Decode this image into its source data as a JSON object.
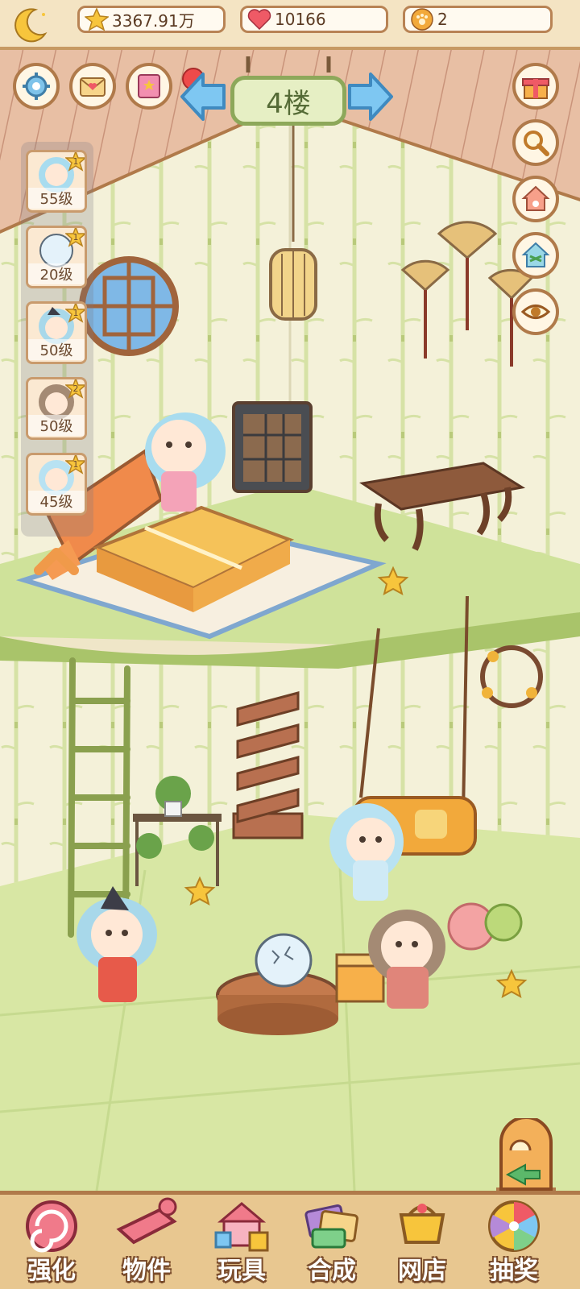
{
  "resources": {
    "stars": "3367.91万",
    "hearts": "10166",
    "paw_coins": "2"
  },
  "floor": {
    "label": "4楼"
  },
  "characters": [
    {
      "level": "55级",
      "badge": "1"
    },
    {
      "level": "20级",
      "badge": "1"
    },
    {
      "level": "50级",
      "badge": "1"
    },
    {
      "level": "50级",
      "badge": "2"
    },
    {
      "level": "45级",
      "badge": "1"
    }
  ],
  "left_buttons": [
    "gear-icon",
    "envelope-heart-icon",
    "book-icon"
  ],
  "right_buttons": [
    "gift-icon",
    "magnifier-icon",
    "house-paw-icon",
    "house-share-icon",
    "eye-icon"
  ],
  "nav": [
    {
      "label": "强化",
      "icon": "lollipop-icon"
    },
    {
      "label": "物件",
      "icon": "piano-icon"
    },
    {
      "label": "玩具",
      "icon": "toy-house-icon"
    },
    {
      "label": "合成",
      "icon": "cards-icon"
    },
    {
      "label": "网店",
      "icon": "shop-basket-icon"
    },
    {
      "label": "抽奖",
      "icon": "prize-wheel-icon"
    }
  ],
  "colors": {
    "wall": "#f3f0d8",
    "floor": "#cfe29a",
    "wood": "#b07a4a",
    "sign_green": "#8da85a",
    "arrow_blue": "#5bb7ee"
  }
}
